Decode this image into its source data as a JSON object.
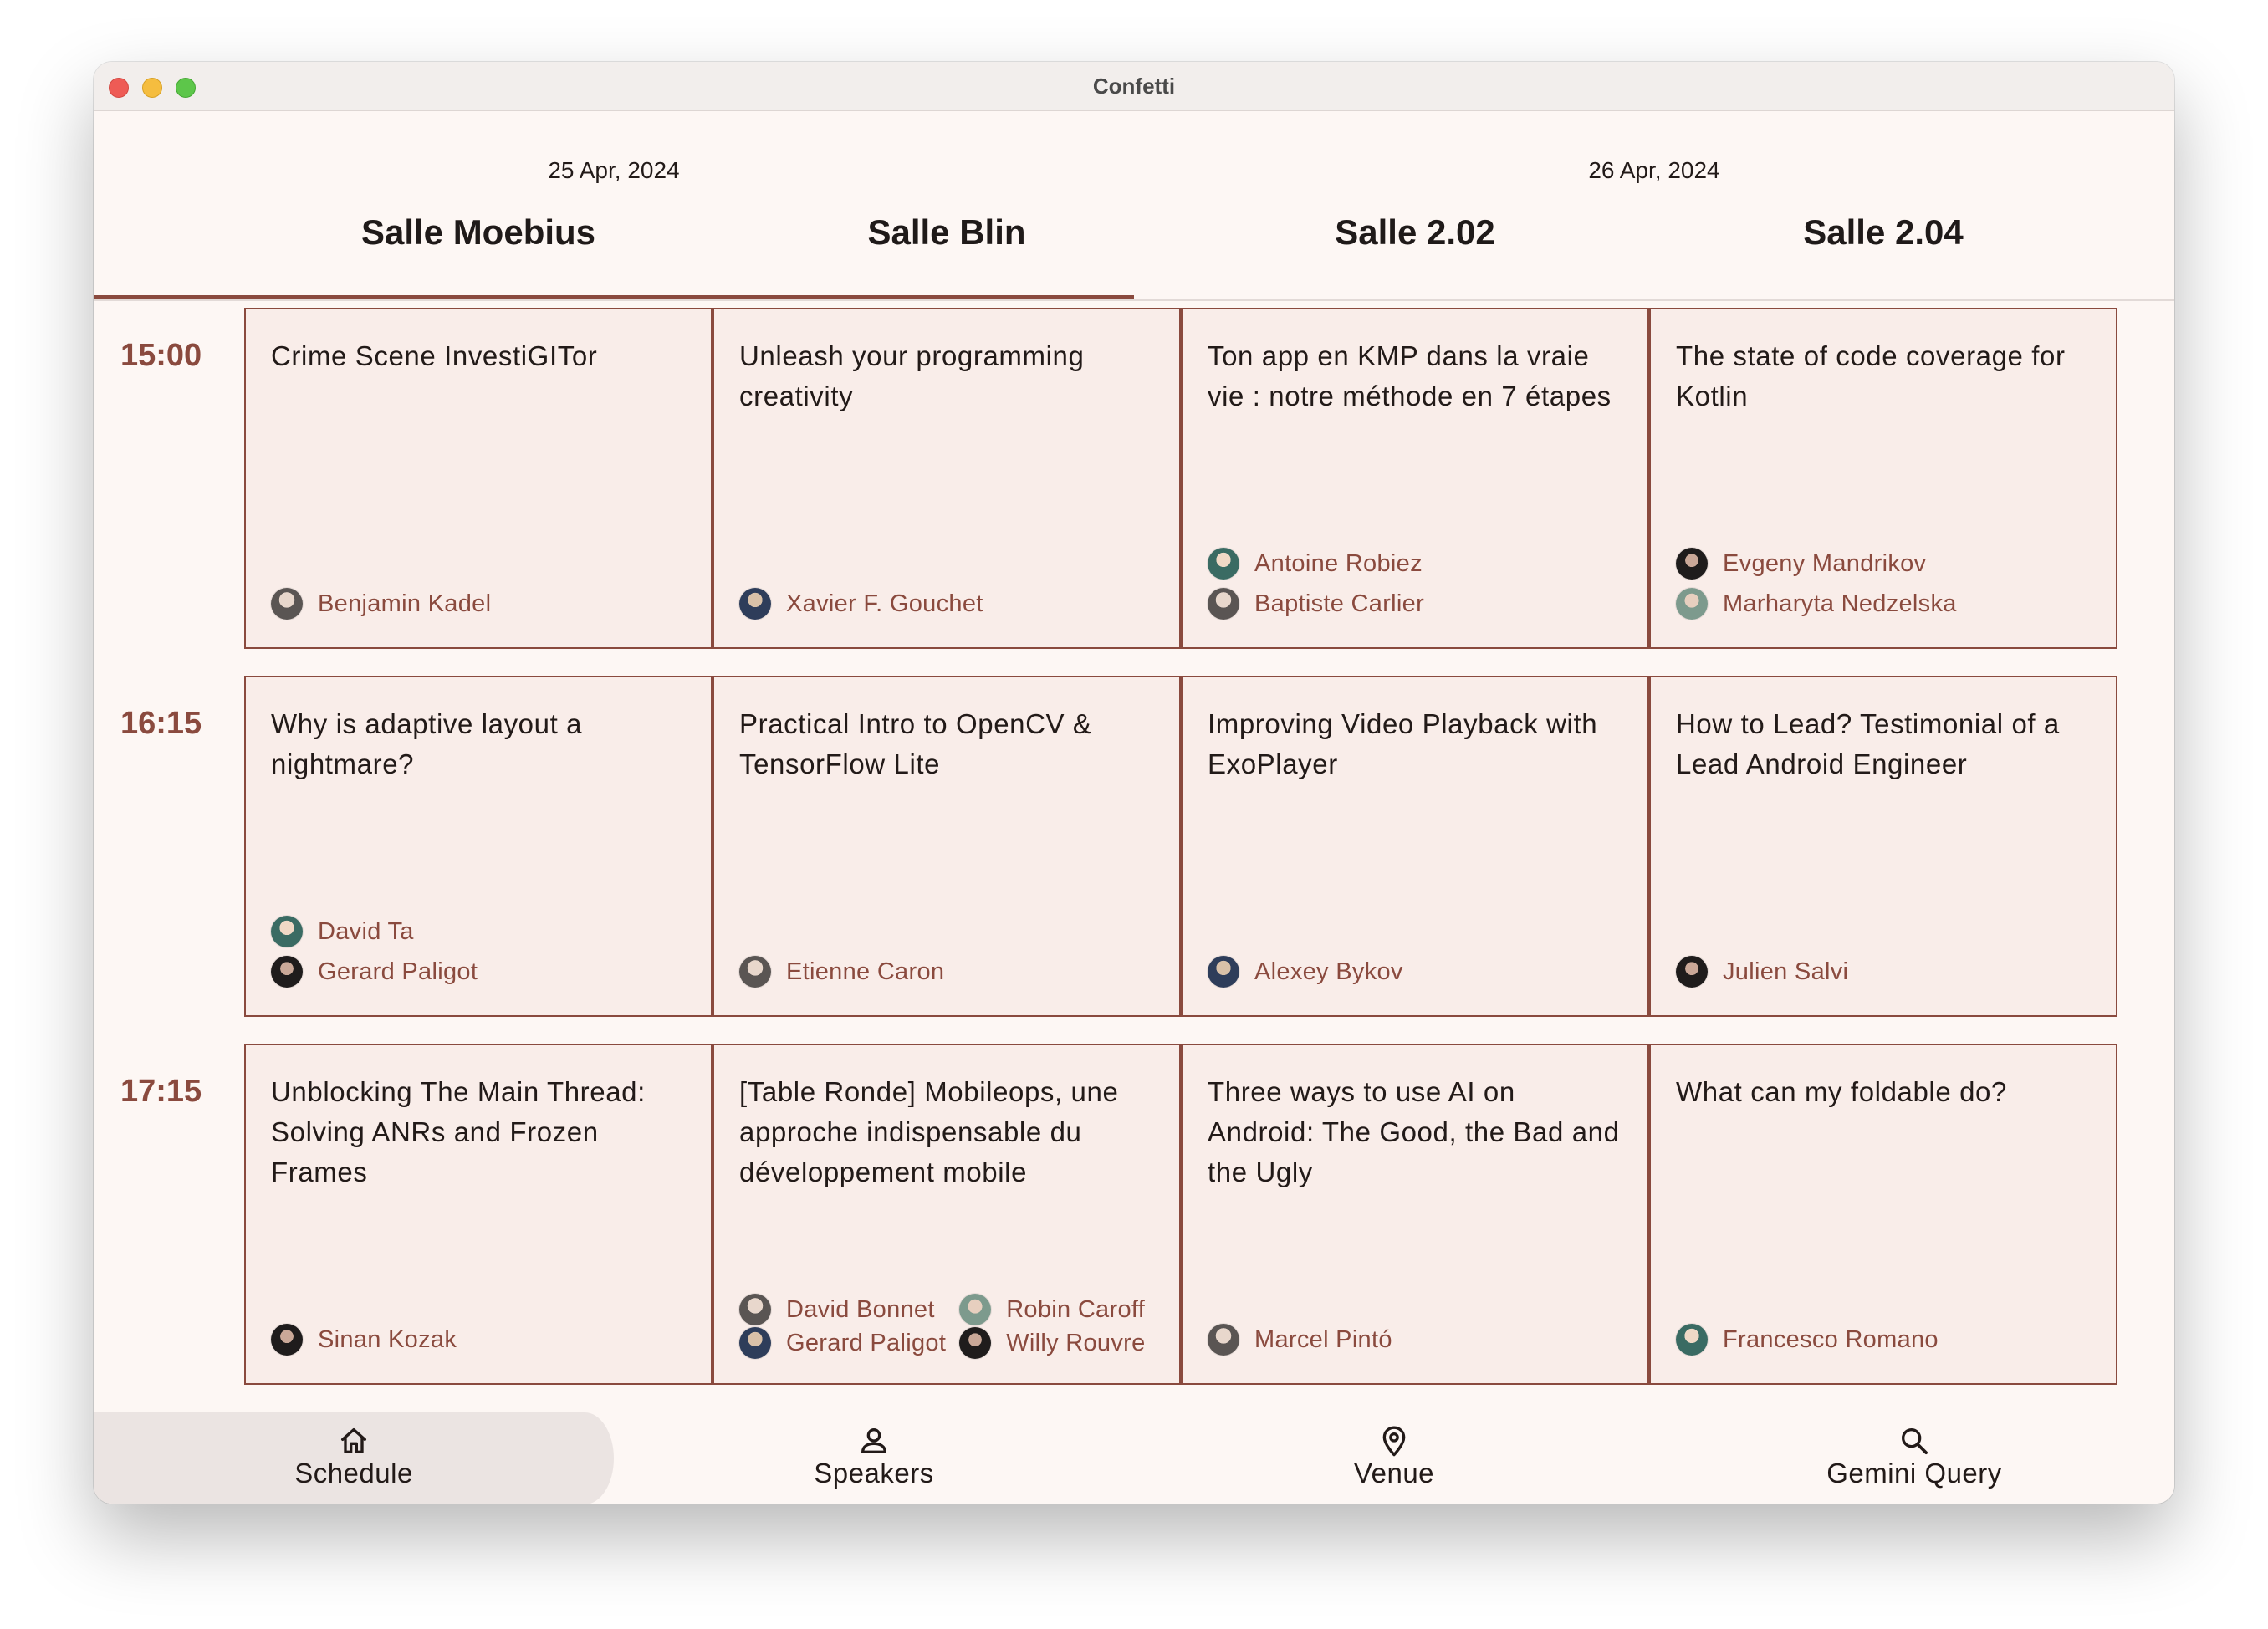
{
  "window": {
    "title": "Confetti"
  },
  "tabs": [
    "25 Apr, 2024",
    "26 Apr, 2024"
  ],
  "rooms": [
    "Salle Moebius",
    "Salle Blin",
    "Salle 2.02",
    "Salle 2.04"
  ],
  "times": [
    "15:00",
    "16:15",
    "17:15"
  ],
  "sessions": [
    [
      {
        "title": "Crime Scene InvestiGITor",
        "speakers": [
          "Benjamin Kadel"
        ]
      },
      {
        "title": "Unleash your programming creativity",
        "speakers": [
          "Xavier F. Gouchet"
        ]
      },
      {
        "title": "Ton app en KMP dans la vraie vie : notre méthode en 7 étapes",
        "speakers": [
          "Antoine Robiez",
          "Baptiste Carlier"
        ]
      },
      {
        "title": "The state of code coverage for Kotlin",
        "speakers": [
          "Evgeny Mandrikov",
          "Marharyta Nedzelska"
        ]
      }
    ],
    [
      {
        "title": "Why is adaptive layout a nightmare?",
        "speakers": [
          "David Ta",
          "Gerard Paligot"
        ]
      },
      {
        "title": "Practical Intro to OpenCV & TensorFlow Lite",
        "speakers": [
          "Etienne Caron"
        ]
      },
      {
        "title": "Improving Video Playback with ExoPlayer",
        "speakers": [
          "Alexey Bykov"
        ]
      },
      {
        "title": "How to Lead? Testimonial of a Lead Android Engineer",
        "speakers": [
          "Julien Salvi"
        ]
      }
    ],
    [
      {
        "title": "Unblocking The Main Thread: Solving ANRs and Frozen Frames",
        "speakers": [
          "Sinan Kozak"
        ]
      },
      {
        "title": "[Table Ronde] Mobileops, une approche indispensable  du développement mobile",
        "speakers": [
          "David Bonnet",
          "Robin Caroff",
          "Gerard Paligot",
          "Willy Rouvre"
        ]
      },
      {
        "title": "Three ways to use AI on Android: The Good, the Bad and the Ugly",
        "speakers": [
          "Marcel Pintó"
        ]
      },
      {
        "title": "What can my foldable do?",
        "speakers": [
          "Francesco Romano"
        ]
      }
    ]
  ],
  "nav": [
    {
      "label": "Schedule",
      "icon": "home-icon"
    },
    {
      "label": "Speakers",
      "icon": "person-icon"
    },
    {
      "label": "Venue",
      "icon": "location-pin-icon"
    },
    {
      "label": "Gemini Query",
      "icon": "search-icon"
    }
  ],
  "colors": {
    "accent": "#8a4a3e",
    "card_bg": "#f9ede9",
    "window_bg": "#fdf7f4"
  }
}
